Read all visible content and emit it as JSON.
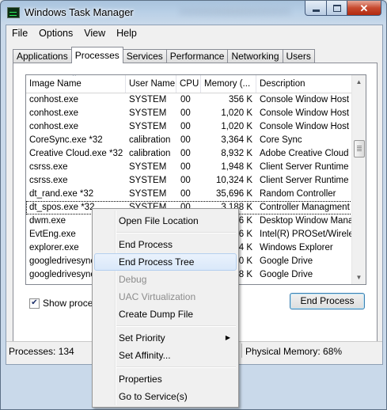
{
  "window": {
    "title": "Windows Task Manager"
  },
  "menubar": [
    "File",
    "Options",
    "View",
    "Help"
  ],
  "tabs": [
    {
      "label": "Applications",
      "active": false
    },
    {
      "label": "Processes",
      "active": true
    },
    {
      "label": "Services",
      "active": false
    },
    {
      "label": "Performance",
      "active": false
    },
    {
      "label": "Networking",
      "active": false
    },
    {
      "label": "Users",
      "active": false
    }
  ],
  "table": {
    "columns": [
      "Image Name",
      "User Name",
      "CPU",
      "Memory (...",
      "Description"
    ],
    "sorted_column": "Image Name",
    "rows": [
      [
        "conhost.exe",
        "SYSTEM",
        "00",
        "356 K",
        "Console Window Host"
      ],
      [
        "conhost.exe",
        "SYSTEM",
        "00",
        "1,020 K",
        "Console Window Host"
      ],
      [
        "conhost.exe",
        "SYSTEM",
        "00",
        "1,020 K",
        "Console Window Host"
      ],
      [
        "CoreSync.exe *32",
        "calibration",
        "00",
        "3,364 K",
        "Core Sync"
      ],
      [
        "Creative Cloud.exe *32",
        "calibration",
        "00",
        "8,932 K",
        "Adobe Creative Cloud"
      ],
      [
        "csrss.exe",
        "SYSTEM",
        "00",
        "1,948 K",
        "Client Server Runtime P"
      ],
      [
        "csrss.exe",
        "SYSTEM",
        "00",
        "10,324 K",
        "Client Server Runtime P"
      ],
      [
        "dt_rand.exe *32",
        "SYSTEM",
        "00",
        "35,696 K",
        "Random Controller"
      ],
      [
        "dt_spos.exe *32",
        "SYSTEM",
        "00",
        "3,188 K",
        "Controller Managment"
      ],
      [
        "dwm.exe",
        "",
        "",
        "6 K",
        "Desktop Window Mana"
      ],
      [
        "EvtEng.exe",
        "",
        "",
        "6 K",
        "Intel(R) PROSet/Wirele"
      ],
      [
        "explorer.exe",
        "",
        "",
        "4 K",
        "Windows Explorer"
      ],
      [
        "googledrivesync.exe",
        "",
        "",
        "0 K",
        "Google Drive"
      ],
      [
        "googledrivesync.exe",
        "",
        "",
        "8 K",
        "Google Drive"
      ]
    ],
    "selected_row": 8
  },
  "footer": {
    "show_all_label": "Show processes from all users",
    "show_all_checked": true,
    "end_process_label": "End Process"
  },
  "status": {
    "processes": "Processes: 134",
    "memory": "Physical Memory: 68%"
  },
  "context_menu": {
    "items": [
      {
        "label": "Open File Location",
        "enabled": true
      },
      {
        "separator": true
      },
      {
        "label": "End Process",
        "enabled": true
      },
      {
        "label": "End Process Tree",
        "enabled": true,
        "highlighted": true
      },
      {
        "label": "Debug",
        "enabled": false
      },
      {
        "label": "UAC Virtualization",
        "enabled": false
      },
      {
        "label": "Create Dump File",
        "enabled": true
      },
      {
        "separator": true
      },
      {
        "label": "Set Priority",
        "enabled": true,
        "submenu": true
      },
      {
        "label": "Set Affinity...",
        "enabled": true
      },
      {
        "separator": true
      },
      {
        "label": "Properties",
        "enabled": true
      },
      {
        "label": "Go to Service(s)",
        "enabled": true
      }
    ]
  },
  "colors": {
    "titlebar": "#b8cfe6",
    "close_button": "#c74a2f",
    "menu_highlight": "#d9e8fa",
    "button_border": "#3c7fb1"
  }
}
